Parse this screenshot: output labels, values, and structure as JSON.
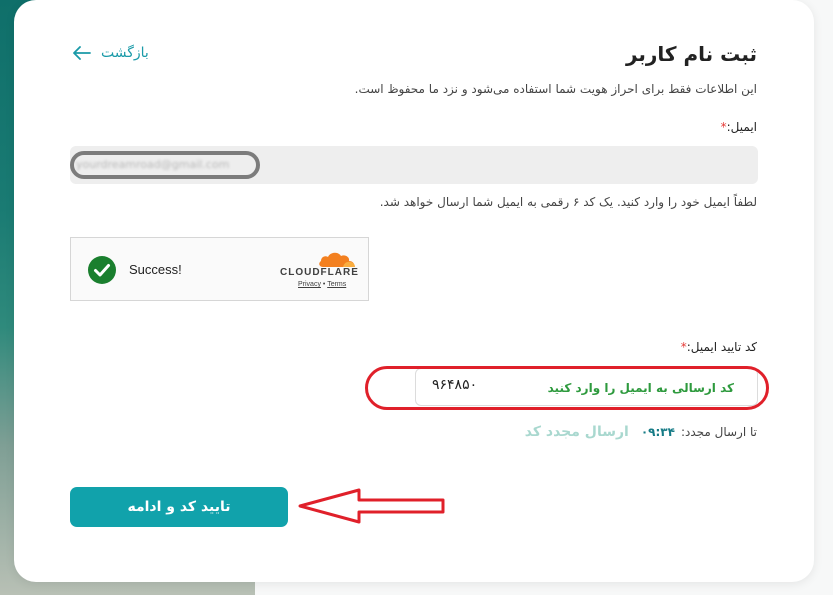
{
  "page": {
    "title": "ثبت نام کاربر",
    "back_label": "بازگشت",
    "subtitle": "این اطلاعات فقط برای احراز هویت شما استفاده می‌شود و نزد ما محفوظ است."
  },
  "email": {
    "label": "ایمیل:",
    "required_mark": "*",
    "value": "yourdreamroad@gmail.com",
    "hint": "لطفاً ایمیل خود را وارد کنید. یک کد ۶ رقمی به ایمیل شما ارسال خواهد شد."
  },
  "captcha": {
    "status": "Success!",
    "brand": "CLOUDFLARE",
    "privacy": "Privacy",
    "separator": "•",
    "terms": "Terms"
  },
  "verification": {
    "label": "کد تایید ایمیل:",
    "required_mark": "*",
    "value": "۹۶۴۸۵۰",
    "annotation": "کد ارسالی به ایمیل را وارد کنید"
  },
  "resend": {
    "label": "تا ارسال مجدد:",
    "timer": "۰۹:۳۴",
    "link": "ارسال مجدد کد"
  },
  "submit": {
    "label": "تایید کد و ادامه"
  },
  "colors": {
    "accent": "#11a2ab",
    "annotation_red": "#e0202a",
    "annotation_green": "#2e9a3e"
  }
}
